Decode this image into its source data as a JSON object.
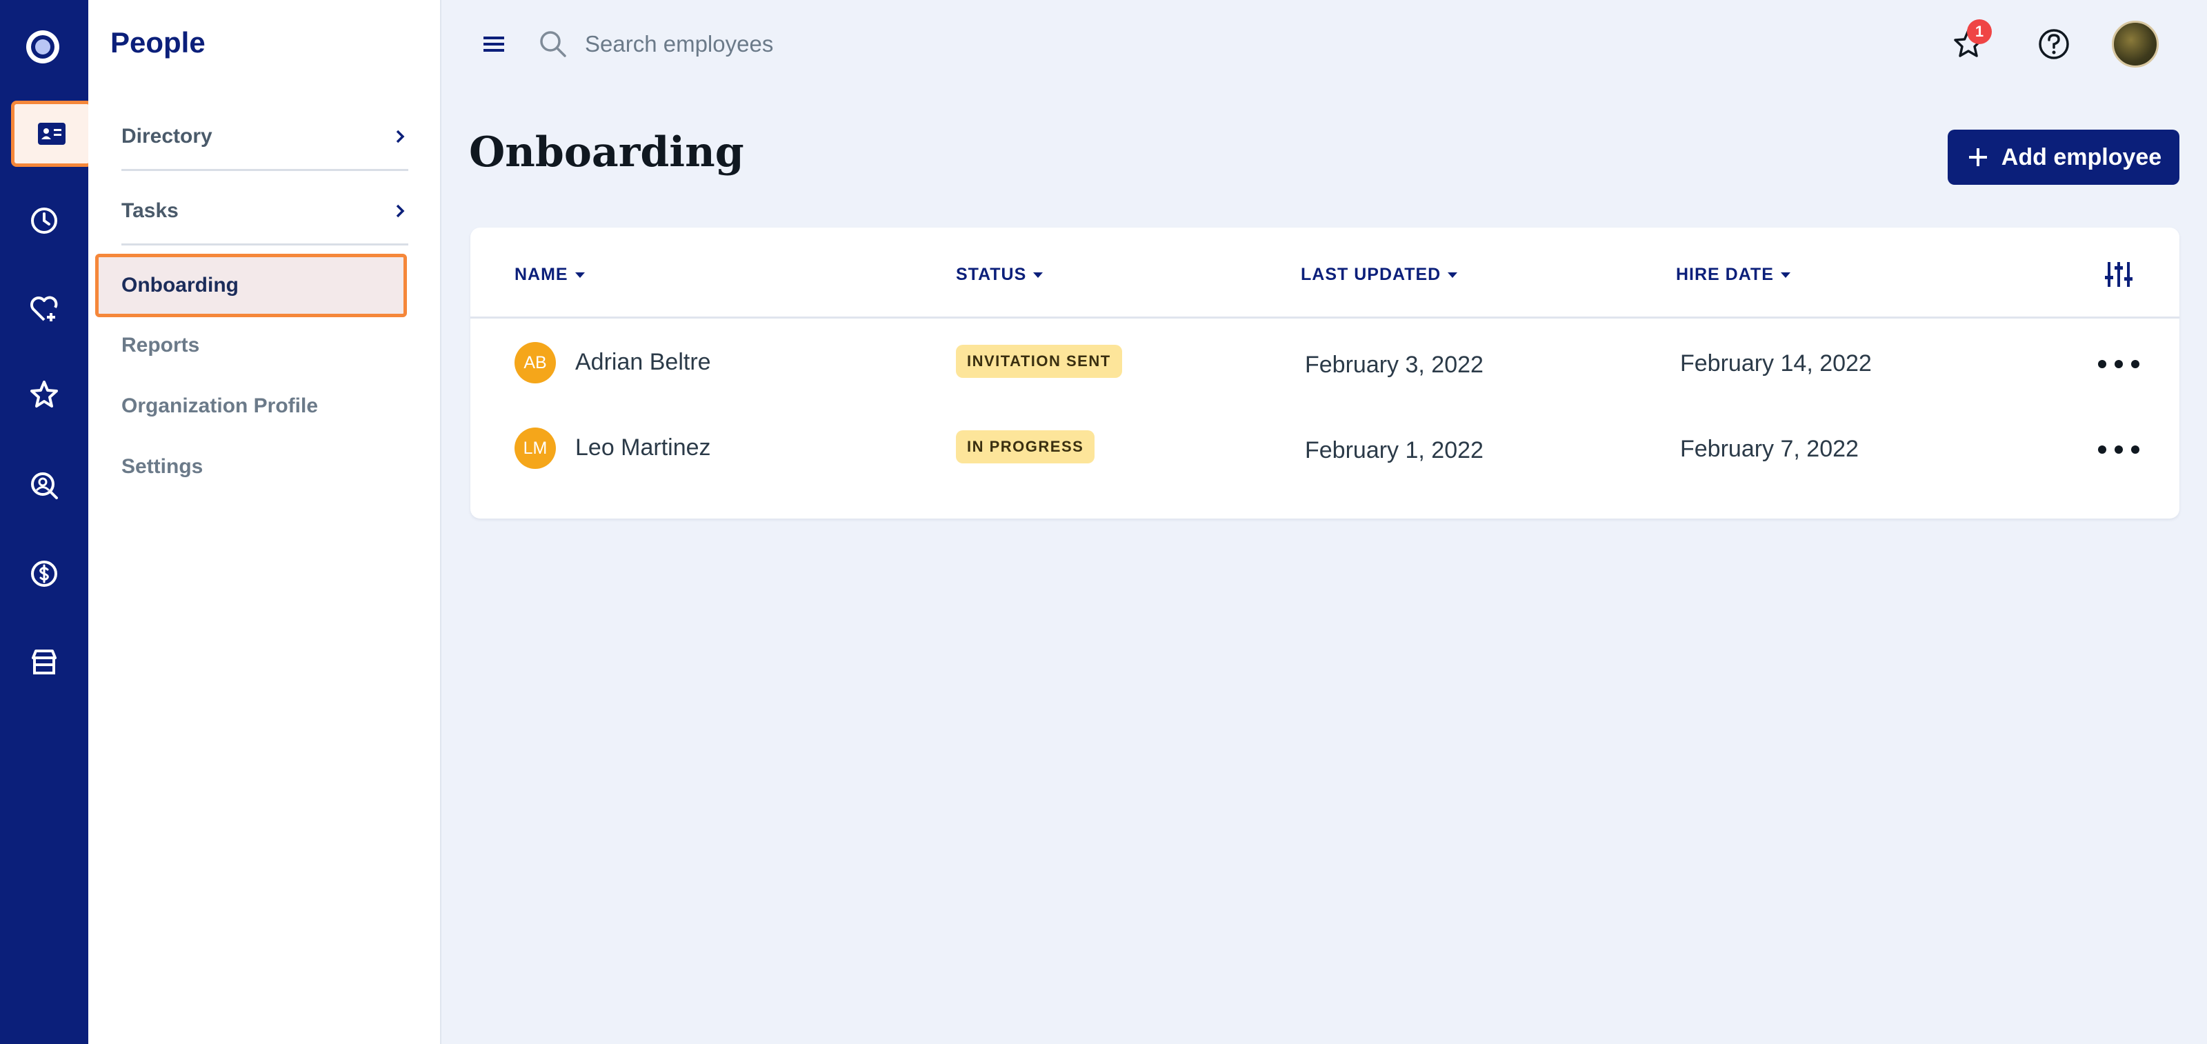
{
  "sidebar": {
    "title": "People",
    "items": [
      {
        "label": "Directory"
      },
      {
        "label": "Tasks"
      },
      {
        "label": "Onboarding"
      },
      {
        "label": "Reports"
      },
      {
        "label": "Organization Profile"
      },
      {
        "label": "Settings"
      }
    ]
  },
  "search": {
    "placeholder": "Search employees"
  },
  "notifications": {
    "count": "1"
  },
  "header": {
    "title": "Onboarding",
    "add_label": "Add employee"
  },
  "table": {
    "columns": [
      "NAME",
      "STATUS",
      "LAST UPDATED",
      "HIRE DATE"
    ],
    "rows": [
      {
        "initials": "AB",
        "name": "Adrian Beltre",
        "status": "INVITATION SENT",
        "last_updated": "February 3, 2022",
        "hire_date": "February 14, 2022"
      },
      {
        "initials": "LM",
        "name": "Leo Martinez",
        "status": "IN PROGRESS",
        "last_updated": "February 1, 2022",
        "hire_date": "February 7, 2022"
      }
    ]
  },
  "colors": {
    "rail": "#0b1f7a",
    "accent": "#f5873a",
    "avatar": "#f5a61a",
    "badge": "#ef4545",
    "status_pill": "#fde59a"
  }
}
